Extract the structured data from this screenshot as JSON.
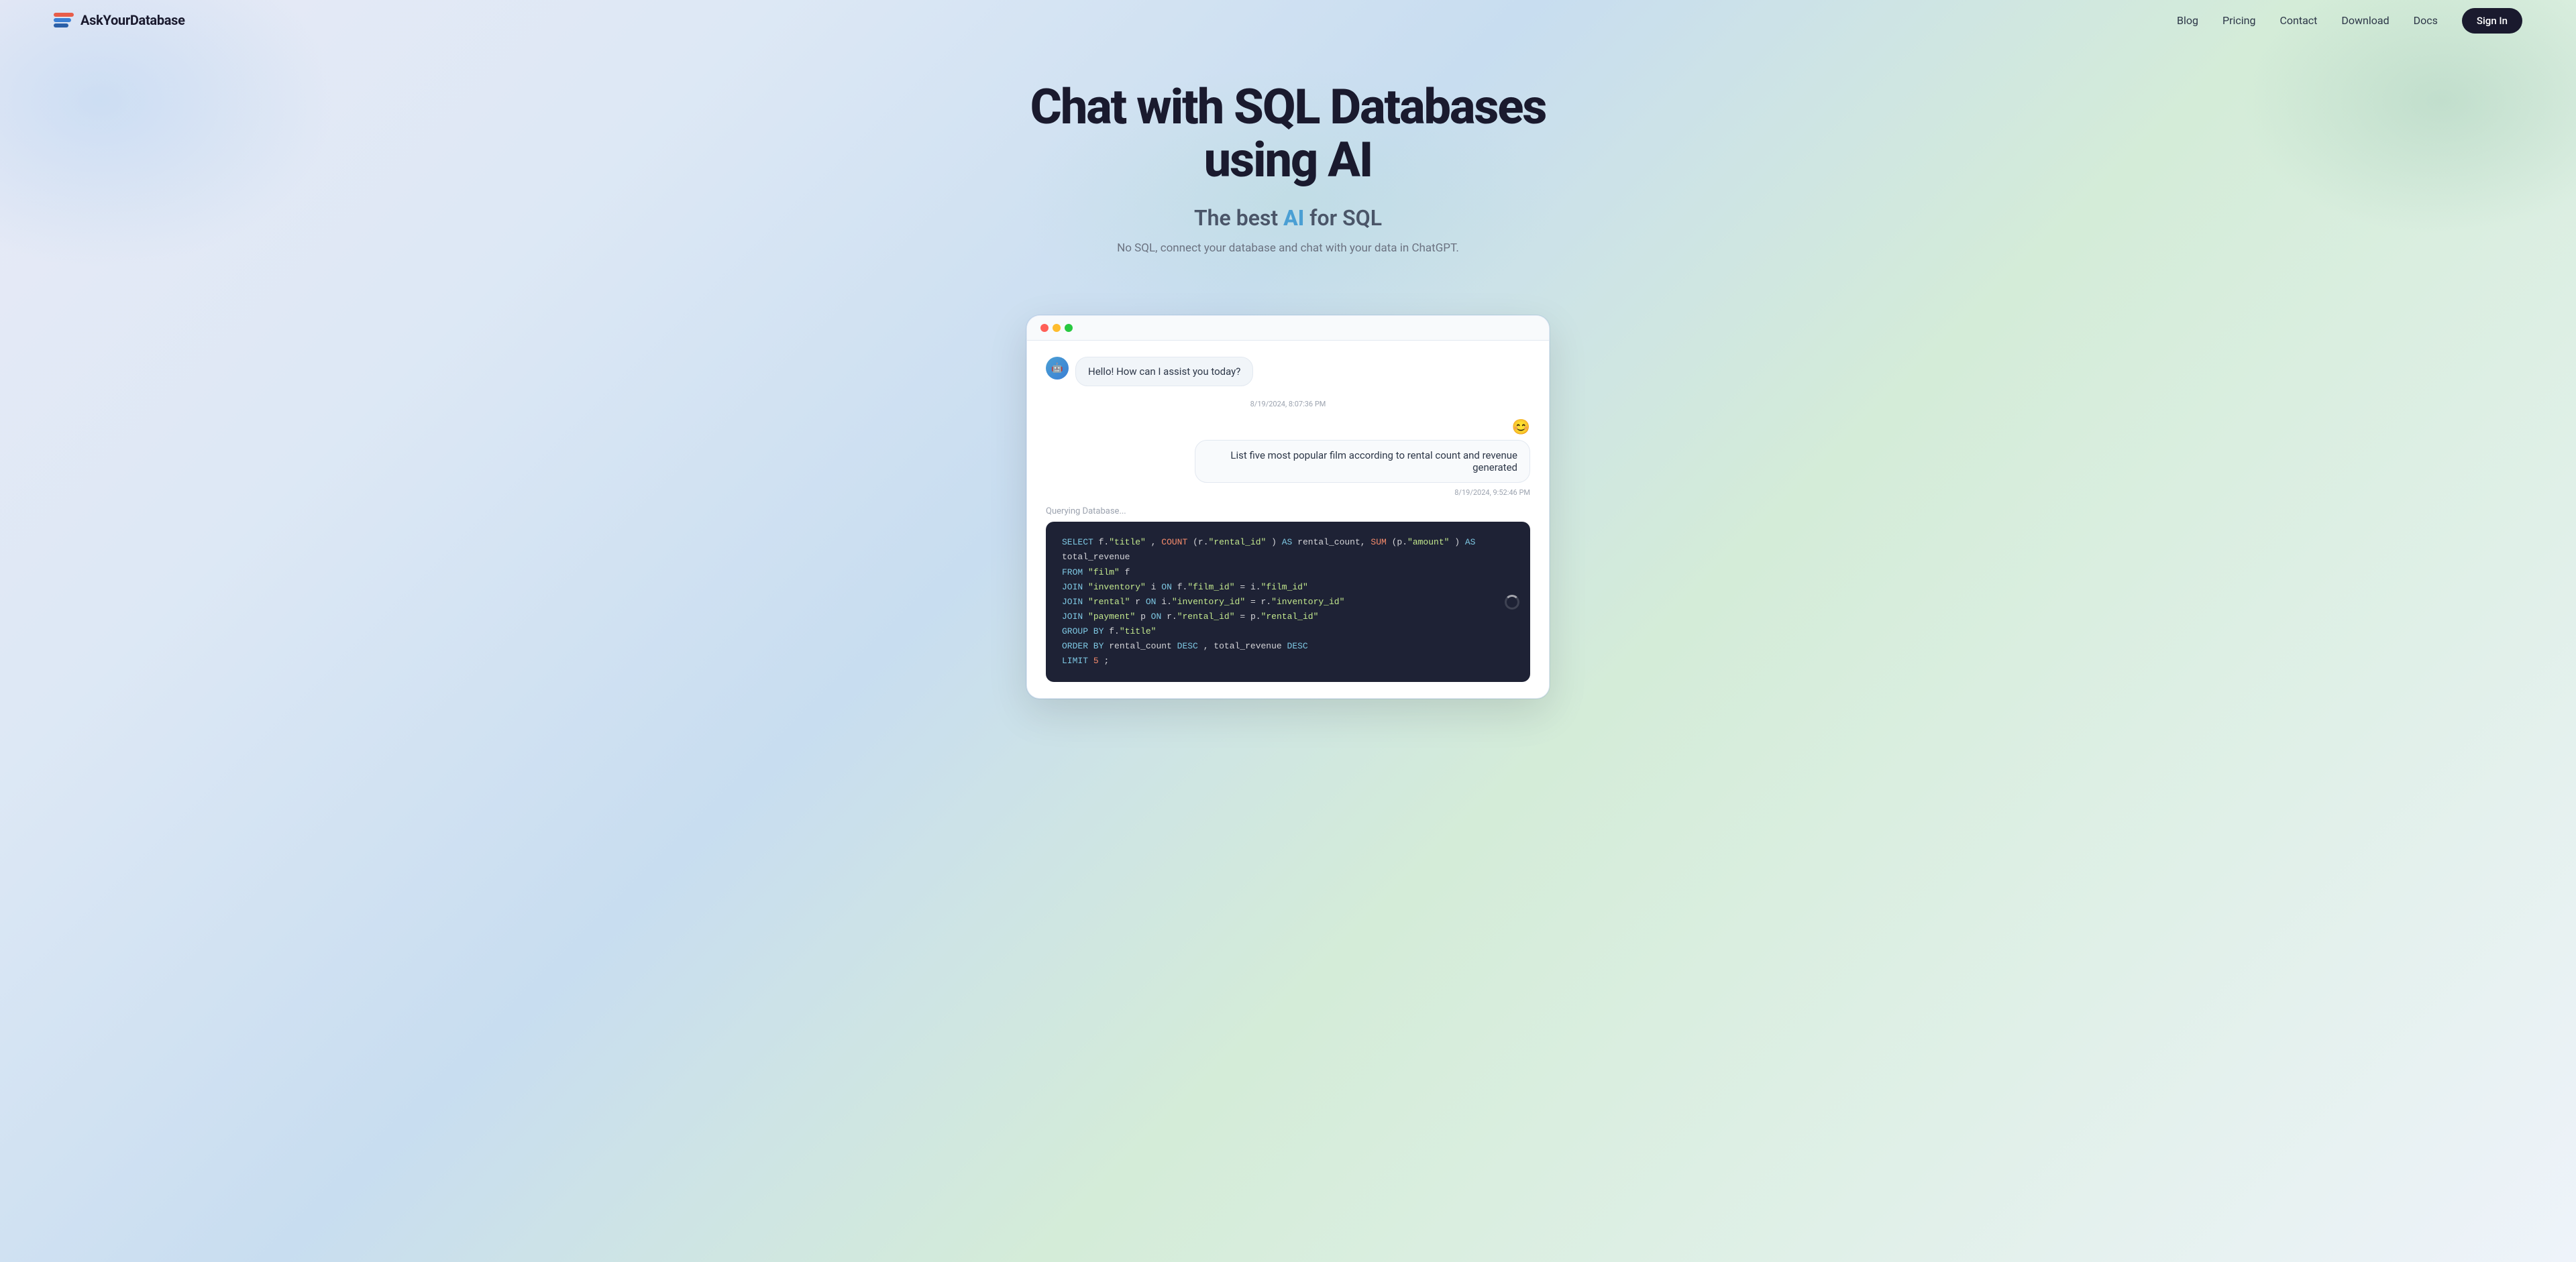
{
  "logo": {
    "text": "AskYourDatabase"
  },
  "nav": {
    "links": [
      {
        "label": "Blog",
        "href": "#"
      },
      {
        "label": "Pricing",
        "href": "#"
      },
      {
        "label": "Contact",
        "href": "#"
      },
      {
        "label": "Download",
        "href": "#"
      },
      {
        "label": "Docs",
        "href": "#"
      }
    ],
    "cta": "Sign In"
  },
  "hero": {
    "title": "Chat with SQL Databases using AI",
    "subtitle_prefix": "The best ",
    "subtitle_ai": "AI",
    "subtitle_suffix": " for SQL",
    "description": "No SQL, connect your database and chat with your data in ChatGPT."
  },
  "chat": {
    "bot_message": "Hello! How can I assist you today?",
    "bot_time": "8/19/2024, 8:07:36 PM",
    "user_message": "List five most popular film according to rental count and revenue generated",
    "user_time": "8/19/2024, 9:52:46 PM",
    "query_label": "Querying Database...",
    "sql_lines": [
      "SELECT f.\"title\", COUNT(r.\"rental_id\") AS rental_count, SUM(p.\"amount\") AS total_revenue",
      "FROM \"film\" f",
      "JOIN \"inventory\" i ON f.\"film_id\" = i.\"film_id\"",
      "JOIN \"rental\" r ON i.\"inventory_id\" = r.\"inventory_id\"",
      "JOIN \"payment\" p ON r.\"rental_id\" = p.\"rental_id\"",
      "GROUP BY f.\"title\"",
      "ORDER BY rental_count DESC, total_revenue DESC",
      "LIMIT 5;"
    ]
  }
}
